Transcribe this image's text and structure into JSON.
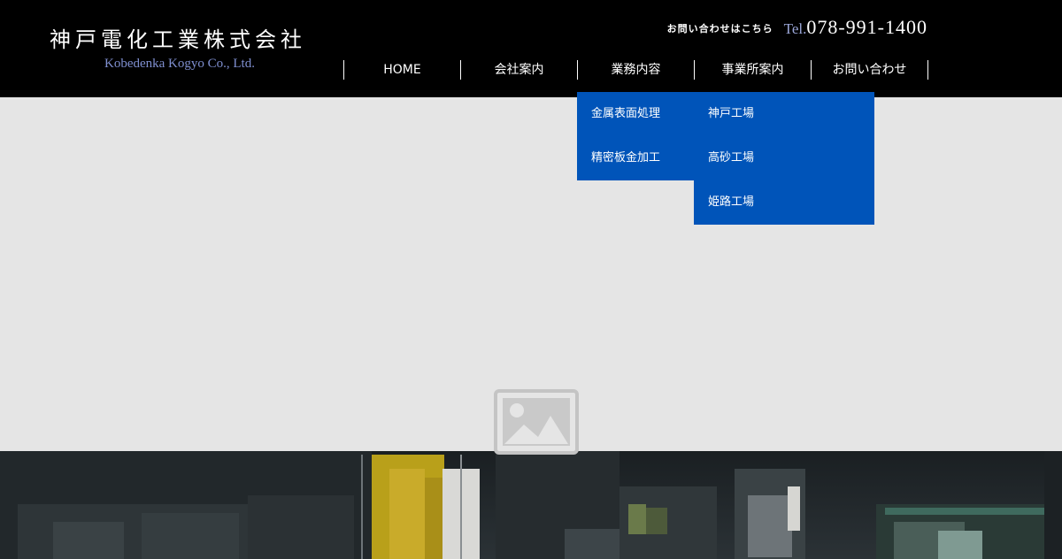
{
  "header": {
    "logo_jp": "神戸電化工業株式会社",
    "logo_en": "Kobedenka Kogyo Co., Ltd.",
    "contact_label": "お問い合わせはこちら",
    "tel_prefix": "Tel.",
    "tel_number": "078-991-1400"
  },
  "nav": {
    "items": [
      {
        "label": "HOME"
      },
      {
        "label": "会社案内"
      },
      {
        "label": "業務内容"
      },
      {
        "label": "事業所案内"
      },
      {
        "label": "お問い合わせ"
      }
    ]
  },
  "dropdowns": {
    "services": [
      "金属表面処理",
      "精密板金加工"
    ],
    "offices": [
      "神戸工場",
      "高砂工場",
      "姫路工場"
    ]
  },
  "colors": {
    "header_bg": "#000000",
    "dropdown_bg": "#0054b9",
    "hero_bg": "#e5e5e5",
    "tel_prefix": "#9aa6d8",
    "logo_en": "#7f8fd0"
  },
  "icons": {
    "hero": "image-placeholder-icon"
  }
}
